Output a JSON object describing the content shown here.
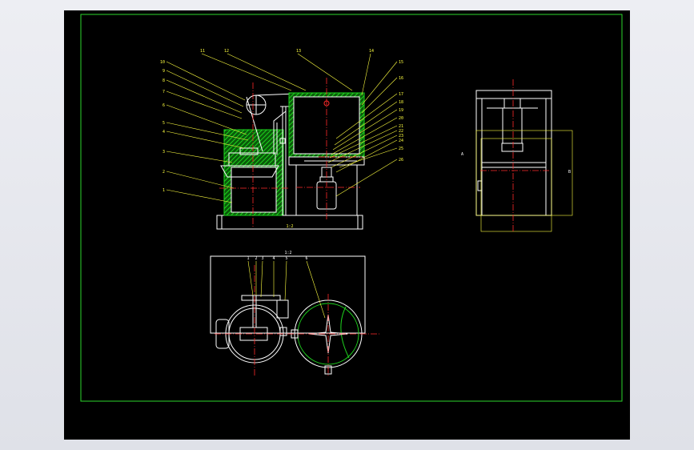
{
  "colors": {
    "background": "#000000",
    "frame": "#2bd62b",
    "outline": "#ffffff",
    "leader": "#ffff40",
    "centerline": "#ff2a2a",
    "hatch": "#1ed31e"
  },
  "drawing": {
    "front_view": {
      "caption": "1:2",
      "balloons": [
        "10",
        "9",
        "8",
        "7",
        "6",
        "5",
        "4",
        "3",
        "2",
        "1",
        "11",
        "12",
        "13",
        "14",
        "15",
        "16",
        "17",
        "18",
        "19",
        "20",
        "21",
        "22",
        "23",
        "24",
        "25",
        "26"
      ]
    },
    "top_view": {
      "caption": "1:2",
      "balloons": [
        "1",
        "2",
        "3",
        "4",
        "5",
        "6"
      ]
    },
    "side_view": {
      "labels": [
        "A",
        "B"
      ]
    }
  }
}
